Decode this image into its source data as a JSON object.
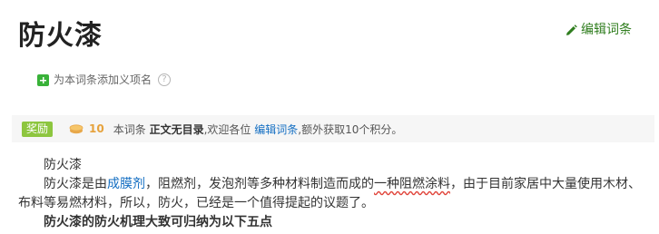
{
  "entry": {
    "title": "防火漆",
    "edit_label": "编辑词条"
  },
  "synonym": {
    "label": "为本词条添加义项名",
    "help_glyph": "?"
  },
  "reward": {
    "badge": "奖励",
    "points": "10",
    "text_prefix": "本词条",
    "text_bold": "正文无目录",
    "text_mid": ",欢迎各位",
    "link_label": "编辑词条",
    "text_suffix": ",额外获取10个积分。"
  },
  "content": {
    "heading": "防火漆",
    "p1_a": "防火漆是由",
    "p1_link1": "成膜剂",
    "p1_b": "，阻燃剂，发泡剂等多种材料制造而成的",
    "p1_underlined": "一种阻燃涂料",
    "p1_c": "，由于目前家居中大量使用木材、",
    "p2": "布料等易燃材料，所以，防火，已经是一个值得提起的议题了。",
    "p3_partial": "防火漆的防火机理大致可归纳为以下五点"
  },
  "colors": {
    "link": "#136ec2",
    "edit": "#2f7d1e",
    "badge": "#8dc63f",
    "points": "#e6a23c"
  },
  "icons": {
    "edit": "pencil-icon",
    "add": "plus-icon",
    "help": "question-circle-icon",
    "coin": "coin-icon"
  }
}
